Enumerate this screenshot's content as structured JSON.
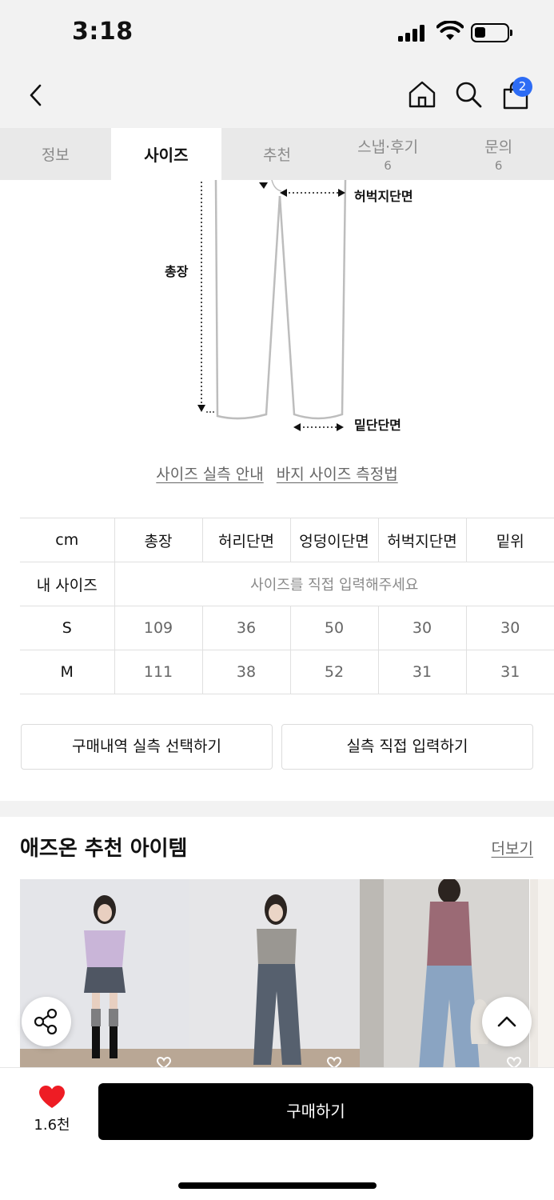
{
  "status_bar": {
    "time": "3:18"
  },
  "nav": {
    "cart_count": "2"
  },
  "tabs": [
    {
      "label": "정보",
      "count": ""
    },
    {
      "label": "사이즈",
      "count": ""
    },
    {
      "label": "추천",
      "count": ""
    },
    {
      "label": "스냅·후기",
      "count": "6"
    },
    {
      "label": "문의",
      "count": "6"
    }
  ],
  "active_tab": "사이즈",
  "diagram": {
    "labels": {
      "thigh": "허벅지단면",
      "length": "총장",
      "hem": "밑단단면"
    }
  },
  "guide_links": [
    "사이즈 실측 안내",
    "바지 사이즈 측정법"
  ],
  "size_table": {
    "headers": [
      "cm",
      "총장",
      "허리단면",
      "엉덩이단면",
      "허벅지단면",
      "밑위"
    ],
    "my_size": {
      "label": "내 사이즈",
      "placeholder": "사이즈를 직접 입력해주세요"
    },
    "rows": [
      {
        "size": "S",
        "values": [
          "109",
          "36",
          "50",
          "30",
          "30"
        ]
      },
      {
        "size": "M",
        "values": [
          "111",
          "38",
          "52",
          "31",
          "31"
        ]
      }
    ]
  },
  "buttons": {
    "select_purchase": "구매내역 실측 선택하기",
    "enter_direct": "실측 직접 입력하기"
  },
  "recommend": {
    "title": "애즈온 추천 아이템",
    "more": "더보기"
  },
  "bottom": {
    "like_count": "1.6천",
    "buy_label": "구매하기"
  },
  "colors": {
    "accent": "#2d6cf5",
    "heart": "#ee1c24",
    "buy": "#000000"
  }
}
